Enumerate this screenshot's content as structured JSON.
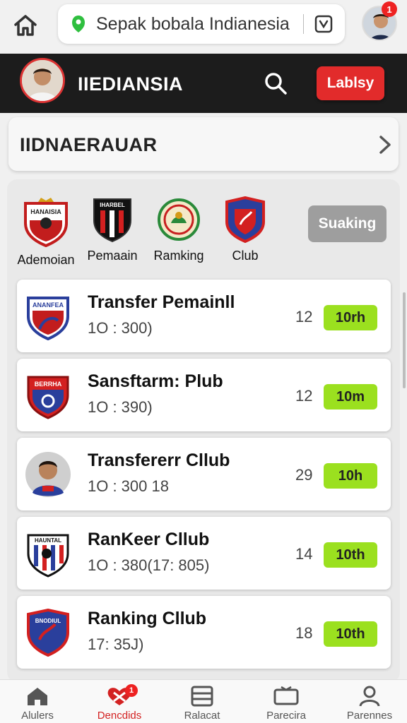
{
  "browser": {
    "url_text": "Sepak bobala Indianesia",
    "notification_count": "1"
  },
  "header": {
    "title": "IIEDIANSIA",
    "action_label": "Lablsy"
  },
  "section": {
    "title": "IIDNAERAUAR"
  },
  "categories": [
    {
      "label": "Ademoian",
      "badge_text": "HANAISIA"
    },
    {
      "label": "Pemaain",
      "badge_text": "IHARBEL"
    },
    {
      "label": "Ramking",
      "badge_text": ""
    },
    {
      "label": "Club",
      "badge_text": ""
    }
  ],
  "ranking_button": "Suaking",
  "list": [
    {
      "title": "Transfer Pemainll",
      "subtitle": "1O : 300)",
      "count": "12",
      "tag": "10rh",
      "badge_text": "ANANFEA"
    },
    {
      "title": "Sansftarm: Plub",
      "subtitle": "1O : 390)",
      "count": "12",
      "tag": "10m",
      "badge_text": "BERRHA"
    },
    {
      "title": "Transfererr Cllub",
      "subtitle": "1O : 300 18",
      "count": "29",
      "tag": "10h",
      "badge_text": ""
    },
    {
      "title": "RanKeer Cllub",
      "subtitle": "1O : 380(17: 805)",
      "count": "14",
      "tag": "10th",
      "badge_text": "HAUNTAL"
    },
    {
      "title": "Ranking Cllub",
      "subtitle": "17: 35J)",
      "count": "18",
      "tag": "10th",
      "badge_text": "BNODIUL"
    }
  ],
  "bottom_nav": [
    {
      "label": "Alulers",
      "icon": "home-icon"
    },
    {
      "label": "Dencdids",
      "icon": "heart-icon",
      "badge": "1"
    },
    {
      "label": "Ralacat",
      "icon": "list-icon"
    },
    {
      "label": "Parecira",
      "icon": "tv-icon"
    },
    {
      "label": "Parennes",
      "icon": "person-icon"
    }
  ],
  "colors": {
    "accent_red": "#e22b2b",
    "tag_green": "#9be01f",
    "header_dark": "#1c1c1c"
  }
}
